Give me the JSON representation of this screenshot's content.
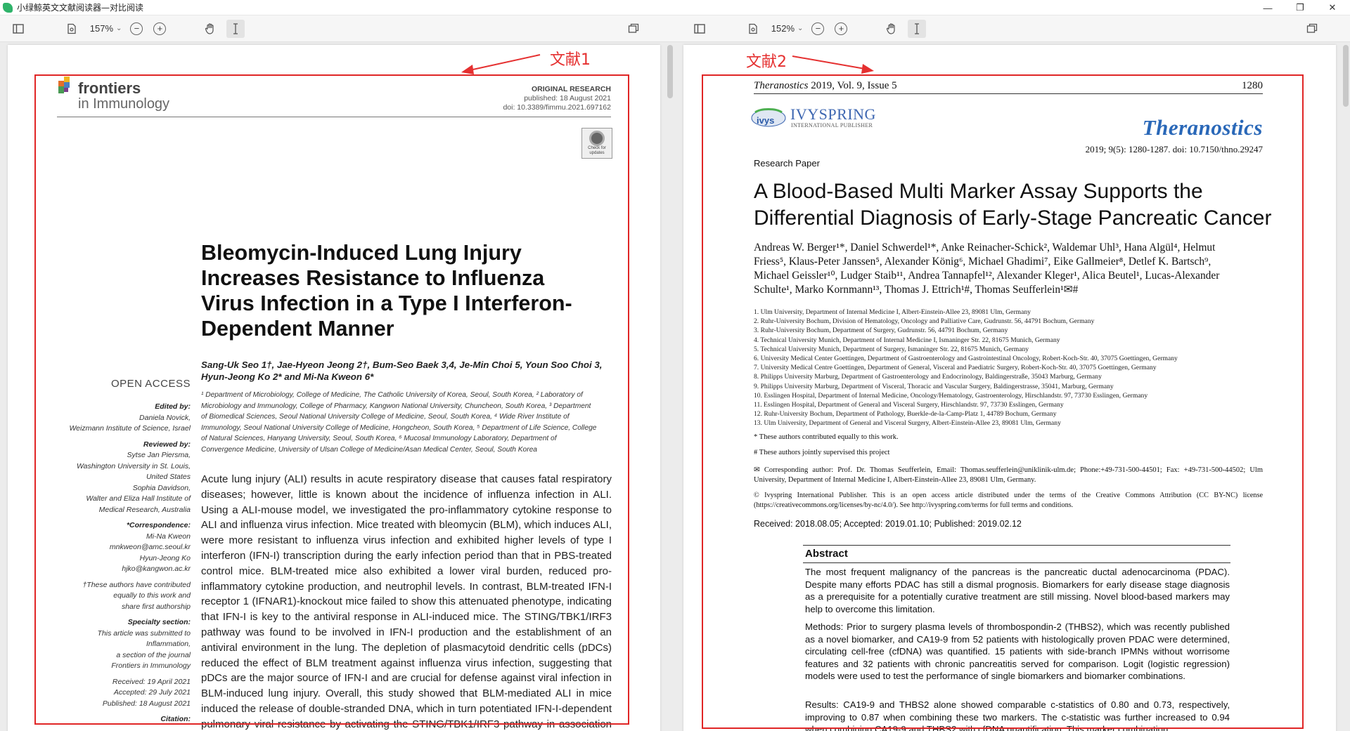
{
  "window": {
    "title": "小绿鲸英文文献阅读器—对比阅读",
    "controls": [
      "—",
      "❐",
      "✕"
    ]
  },
  "left_toolbar": {
    "zoom": "157%"
  },
  "right_toolbar": {
    "zoom": "152%"
  },
  "annotations": {
    "left_label": "文献1",
    "right_label": "文献2"
  },
  "doc1": {
    "journal_main": "frontiers",
    "journal_sub": "in Immunology",
    "article_type": "ORIGINAL RESEARCH",
    "published": "published: 18 August 2021",
    "doi": "doi: 10.3389/fimmu.2021.697162",
    "check_label": "Check for updates",
    "title_lines": [
      "Bleomycin-Induced Lung Injury",
      "Increases Resistance to Influenza",
      "Virus Infection in a Type I Interferon-",
      "Dependent Manner"
    ],
    "authors_line1": "Sang-Uk Seo 1†, Jae-Hyeon Jeong 2†, Bum-Seo Baek 3,4, Je-Min Choi 5, Youn Soo Choi 3,",
    "authors_line2": "Hyun-Jeong Ko 2* and Mi-Na Kweon 6*",
    "open_access": "OPEN ACCESS",
    "affiliations": [
      "¹ Department of Microbiology, College of Medicine, The Catholic University of Korea, Seoul, South Korea, ² Laboratory of",
      "Microbiology and Immunology, College of Pharmacy, Kangwon National University, Chuncheon, South Korea, ³ Department",
      "of Biomedical Sciences, Seoul National University College of Medicine, Seoul, South Korea, ⁴ Wide River Institute of",
      "Immunology, Seoul National University College of Medicine, Hongcheon, South Korea, ⁵ Department of Life Science, College",
      "of Natural Sciences, Hanyang University, Seoul, South Korea, ⁶ Mucosal Immunology Laboratory, Department of",
      "Convergence Medicine, University of Ulsan College of Medicine/Asan Medical Center, Seoul, South Korea"
    ],
    "sidebar": [
      {
        "text": "Edited by:",
        "bold": true
      },
      {
        "text": "Daniela Novick,",
        "bold": false
      },
      {
        "text": "Weizmann Institute of Science, Israel",
        "bold": false
      },
      {
        "text": "",
        "bold": false
      },
      {
        "text": "Reviewed by:",
        "bold": true
      },
      {
        "text": "Sytse Jan Piersma,",
        "bold": false
      },
      {
        "text": "Washington University in St. Louis,",
        "bold": false
      },
      {
        "text": "United States",
        "bold": false
      },
      {
        "text": "Sophia Davidson,",
        "bold": false
      },
      {
        "text": "Walter and Eliza Hall Institute of",
        "bold": false
      },
      {
        "text": "Medical Research, Australia",
        "bold": false
      },
      {
        "text": "",
        "bold": false
      },
      {
        "text": "*Correspondence:",
        "bold": true
      },
      {
        "text": "Mi-Na Kweon",
        "bold": false
      },
      {
        "text": "mnkweon@amc.seoul.kr",
        "bold": false
      },
      {
        "text": "Hyun-Jeong Ko",
        "bold": false
      },
      {
        "text": "hjko@kangwon.ac.kr",
        "bold": false
      },
      {
        "text": "",
        "bold": false
      },
      {
        "text": "†These authors have contributed",
        "bold": false
      },
      {
        "text": "equally to this work and",
        "bold": false
      },
      {
        "text": "share first authorship",
        "bold": false
      },
      {
        "text": "",
        "bold": false
      },
      {
        "text": "Specialty section:",
        "bold": true
      },
      {
        "text": "This article was submitted to",
        "bold": false
      },
      {
        "text": "Inflammation,",
        "bold": false
      },
      {
        "text": "a section of the journal",
        "bold": false
      },
      {
        "text": "Frontiers in Immunology",
        "bold": false
      },
      {
        "text": "",
        "bold": false
      },
      {
        "text": "Received: 19 April 2021",
        "bold": false
      },
      {
        "text": "Accepted: 29 July 2021",
        "bold": false
      },
      {
        "text": "Published: 18 August 2021",
        "bold": false
      },
      {
        "text": "",
        "bold": false
      },
      {
        "text": "Citation:",
        "bold": true
      }
    ],
    "abstract": "Acute lung injury (ALI) results in acute respiratory disease that causes fatal respiratory diseases; however, little is known about the incidence of influenza infection in ALI. Using a ALI-mouse model, we investigated the pro-inflammatory cytokine response to ALI and influenza virus infection. Mice treated with bleomycin (BLM), which induces ALI, were more resistant to influenza virus infection and exhibited higher levels of type I interferon (IFN-I) transcription during the early infection period than that in PBS-treated control mice. BLM-treated mice also exhibited a lower viral burden, reduced pro-inflammatory cytokine production, and neutrophil levels. In contrast, BLM-treated IFN-I receptor 1 (IFNAR1)-knockout mice failed to show this attenuated phenotype, indicating that IFN-I is key to the antiviral response in ALI-induced mice. The STING/TBK1/IRF3 pathway was found to be involved in IFN-I production and the establishment of an antiviral environment in the lung. The depletion of plasmacytoid dendritic cells (pDCs) reduced the effect of BLM treatment against influenza virus infection, suggesting that pDCs are the major source of IFN-I and are crucial for defense against viral infection in BLM-induced lung injury. Overall, this study showed that BLM-mediated ALI in mice induced the release of double-stranded DNA, which in turn potentiated IFN-I-dependent pulmonary viral resistance by activating the STING/TBK1/IRF3 pathway in association with pDCs."
  },
  "doc2": {
    "header_journal": "Theranostics",
    "header_rest": " 2019, Vol. 9, Issue 5",
    "header_page": "1280",
    "publisher": "IVYSPRING",
    "publisher_sub": "INTERNATIONAL PUBLISHER",
    "journal_logo": "Theranostics",
    "citation": "2019; 9(5): 1280-1287. doi: 10.7150/thno.29247",
    "paper_type": "Research Paper",
    "title_lines": [
      "A Blood-Based Multi Marker Assay Supports the",
      "Differential Diagnosis of Early-Stage Pancreatic Cancer"
    ],
    "authors": [
      "Andreas W. Berger¹*, Daniel Schwerdel¹*, Anke Reinacher-Schick², Waldemar Uhl³, Hana Algül⁴, Helmut",
      "Friess⁵, Klaus-Peter Janssen⁵, Alexander König⁶, Michael Ghadimi⁷, Eike Gallmeier⁸, Detlef K. Bartsch⁹,",
      "Michael Geissler¹⁰, Ludger Staib¹¹, Andrea Tannapfel¹², Alexander Kleger¹, Alica Beutel¹, Lucas-Alexander",
      "Schulte¹, Marko Kornmann¹³, Thomas J. Ettrich¹#, Thomas Seufferlein¹✉#"
    ],
    "affiliations": [
      "1.    Ulm University, Department of Internal Medicine I, Albert-Einstein-Allee 23, 89081 Ulm, Germany",
      "2.    Ruhr-University Bochum, Division of Hematology, Oncology and Palliative Care, Gudrunstr. 56, 44791 Bochum, Germany",
      "3.    Ruhr-University Bochum, Department of Surgery, Gudrunstr. 56, 44791 Bochum, Germany",
      "4.    Technical University Munich, Department of Internal Medicine I, Ismaninger Str. 22, 81675 Munich, Germany",
      "5.    Technical University Munich, Department of Surgery, Ismaninger Str. 22, 81675 Munich, Germany",
      "6.    University Medical Center Goettingen, Department of Gastroenterology and Gastrointestinal Oncology, Robert-Koch-Str. 40, 37075 Goettingen, Germany",
      "7.    University Medical Centre Goettingen, Department of General, Visceral and Paediatric Surgery, Robert-Koch-Str. 40, 37075 Goettingen, Germany",
      "8.    Philipps University Marburg, Department of Gastroenterology and Endocrinology, Baldingerstraße, 35043 Marburg, Germany",
      "9.    Philipps University Marburg, Department of Visceral, Thoracic and Vascular Surgery, Baldingerstrasse, 35041, Marburg, Germany",
      "10.   Esslingen Hospital, Department of Internal Medicine, Oncology/Hematology, Gastroenterology, Hirschlandstr. 97, 73730 Esslingen, Germany",
      "11.   Esslingen Hospital, Department of General and Visceral Surgery, Hirschlandstr. 97, 73730 Esslingen, Germany",
      "12.   Ruhr-University Bochum, Department of Pathology, Buerkle-de-la-Camp-Platz 1, 44789 Bochum, Germany",
      "13.   Ulm University, Department of General and Visceral Surgery, Albert-Einstein-Allee 23, 89081 Ulm, Germany"
    ],
    "note1": "* These authors contributed equally to this work.",
    "note2": "# These authors jointly supervised this project",
    "corresponding": "✉ Corresponding author: Prof. Dr. Thomas Seufferlein, Email: Thomas.seufferlein@uniklinik-ulm.de; Phone:+49-731-500-44501; Fax: +49-731-500-44502; Ulm University, Department of Internal Medicine I, Albert-Einstein-Allee 23, 89081 Ulm, Germany.",
    "license": "© Ivyspring International Publisher. This is an open access article distributed under the terms of the Creative Commons Attribution (CC BY-NC) license (https://creativecommons.org/licenses/by-nc/4.0/). See http://ivyspring.com/terms for full terms and conditions.",
    "dates": "Received: 2018.08.05; Accepted: 2019.01.10; Published: 2019.02.12",
    "abstract_heading": "Abstract",
    "abstract_p1": "The most frequent malignancy of the pancreas is the pancreatic ductal adenocarcinoma (PDAC). Despite many efforts PDAC has still a dismal prognosis. Biomarkers for early disease stage diagnosis as a prerequisite for a potentially curative treatment are still missing. Novel blood-based markers may help to overcome this limitation.",
    "abstract_p2": "Methods: Prior to surgery plasma levels of thrombospondin-2 (THBS2), which was recently published as a novel biomarker, and CA19-9 from 52 patients with histologically proven PDAC were determined, circulating cell-free (cfDNA) was quantified. 15 patients with side-branch IPMNs without worrisome features and 32 patients with chronic pancreatitis served for comparison. Logit (logistic regression) models were used to test the performance of single biomarkers and biomarker combinations.",
    "abstract_p3": "Results: CA19-9 and THBS2 alone showed comparable c-statistics of 0.80 and 0.73, respectively, improving to 0.87 when combining these two markers. The c-statistic was further increased to 0.94 when combining CA19-9 and THBS2 with cfDNA quantification. This marker combination"
  }
}
